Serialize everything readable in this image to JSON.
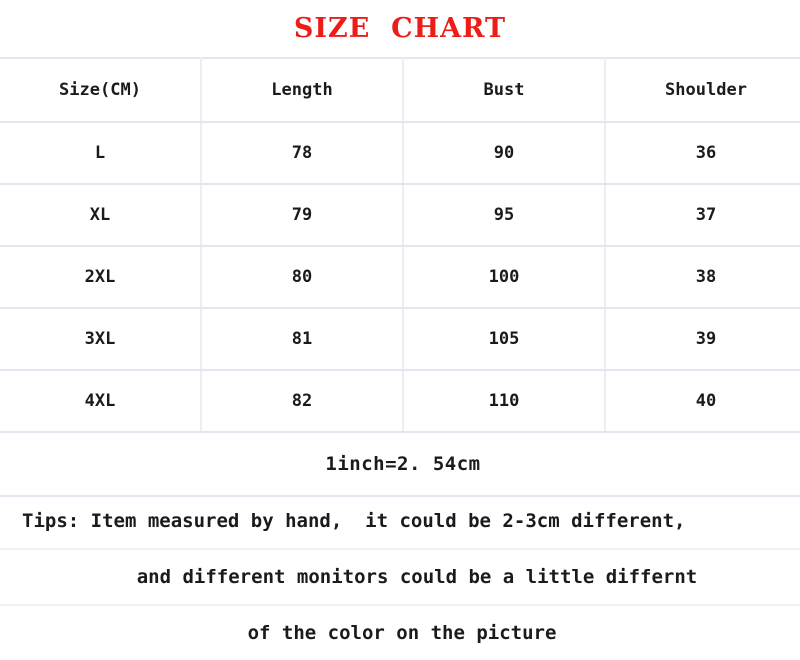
{
  "title": "SIZE  CHART",
  "colors": {
    "title": "#ee1c17",
    "text": "#1b1b1b",
    "grid": "#e3e5f0",
    "background": "#ffffff"
  },
  "table": {
    "headers": [
      "Size(CM)",
      "Length",
      "Bust",
      "Shoulder"
    ],
    "rows": [
      {
        "size": "L",
        "length": "78",
        "bust": "90",
        "shoulder": "36"
      },
      {
        "size": "XL",
        "length": "79",
        "bust": "95",
        "shoulder": "37"
      },
      {
        "size": "2XL",
        "length": "80",
        "bust": "100",
        "shoulder": "38"
      },
      {
        "size": "3XL",
        "length": "81",
        "bust": "105",
        "shoulder": "39"
      },
      {
        "size": "4XL",
        "length": "82",
        "bust": "110",
        "shoulder": "40"
      }
    ],
    "conversion": "1inch=2. 54cm"
  },
  "tips": {
    "line1": "Tips: Item measured by hand,  it could be 2-3cm different,",
    "line2": "and different monitors could be a little differnt",
    "line3": "of the color on the picture"
  },
  "chart_data": {
    "type": "table",
    "title": "SIZE  CHART",
    "columns": [
      "Size(CM)",
      "Length",
      "Bust",
      "Shoulder"
    ],
    "units": "cm",
    "rows": [
      [
        "L",
        78,
        90,
        36
      ],
      [
        "XL",
        79,
        95,
        37
      ],
      [
        "2XL",
        80,
        100,
        38
      ],
      [
        "3XL",
        81,
        105,
        39
      ],
      [
        "4XL",
        82,
        110,
        40
      ]
    ],
    "series": [
      {
        "name": "Length",
        "categories": [
          "L",
          "XL",
          "2XL",
          "3XL",
          "4XL"
        ],
        "values": [
          78,
          79,
          80,
          81,
          82
        ]
      },
      {
        "name": "Bust",
        "categories": [
          "L",
          "XL",
          "2XL",
          "3XL",
          "4XL"
        ],
        "values": [
          90,
          95,
          100,
          105,
          110
        ]
      },
      {
        "name": "Shoulder",
        "categories": [
          "L",
          "XL",
          "2XL",
          "3XL",
          "4XL"
        ],
        "values": [
          36,
          37,
          38,
          39,
          40
        ]
      }
    ],
    "notes": [
      "1inch=2.54cm",
      "Tips: Item measured by hand,  it could be 2-3cm different,",
      "and different monitors could be a little differnt",
      "of the color on the picture"
    ]
  }
}
